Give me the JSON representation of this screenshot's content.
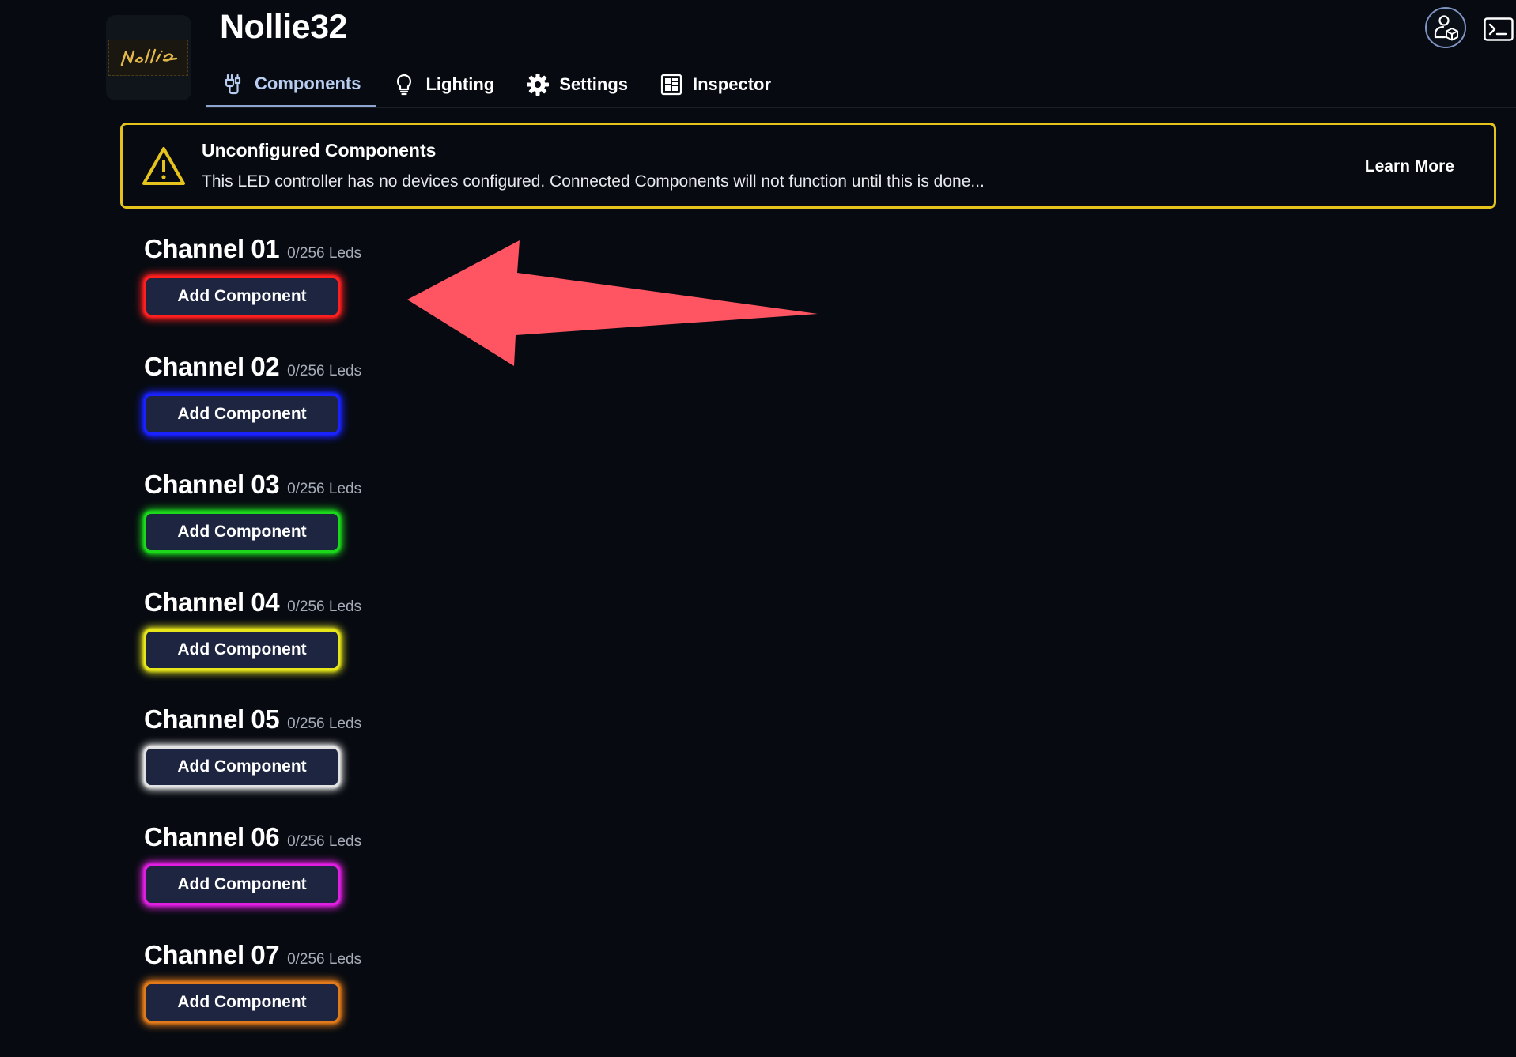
{
  "device": {
    "title": "Nollie32",
    "thumbnail_icon": "nollie-logo-thumbnail"
  },
  "tabs": [
    {
      "label": "Components",
      "icon": "components-icon",
      "active": true
    },
    {
      "label": "Lighting",
      "icon": "lightbulb-icon",
      "active": false
    },
    {
      "label": "Settings",
      "icon": "gear-icon",
      "active": false
    },
    {
      "label": "Inspector",
      "icon": "inspector-icon",
      "active": false
    }
  ],
  "toolbar": {
    "user_icon": "user-cube-icon",
    "console_icon": "terminal-icon"
  },
  "warning": {
    "icon": "warning-triangle-icon",
    "title": "Unconfigured Components",
    "message": "This LED controller has no devices configured. Connected Components will not function until this is done...",
    "action_label": "Learn More",
    "border_color": "#e6c31c"
  },
  "channels": [
    {
      "name": "Channel 01",
      "leds": "0/256 Leds",
      "button_label": "Add Component",
      "glow_color": "#ff1f1f"
    },
    {
      "name": "Channel 02",
      "leds": "0/256 Leds",
      "button_label": "Add Component",
      "glow_color": "#1a22ff"
    },
    {
      "name": "Channel 03",
      "leds": "0/256 Leds",
      "button_label": "Add Component",
      "glow_color": "#1bd81b"
    },
    {
      "name": "Channel 04",
      "leds": "0/256 Leds",
      "button_label": "Add Component",
      "glow_color": "#e6e61a"
    },
    {
      "name": "Channel 05",
      "leds": "0/256 Leds",
      "button_label": "Add Component",
      "glow_color": "#e2e2e2"
    },
    {
      "name": "Channel 06",
      "leds": "0/256 Leds",
      "button_label": "Add Component",
      "glow_color": "#e01fe0"
    },
    {
      "name": "Channel 07",
      "leds": "0/256 Leds",
      "button_label": "Add Component",
      "glow_color": "#e07a1a"
    }
  ],
  "colors": {
    "background": "#070b11",
    "active_tab": "#b8cdf0",
    "button_fill": "#1e2540",
    "annotation_arrow": "#ff5562"
  }
}
